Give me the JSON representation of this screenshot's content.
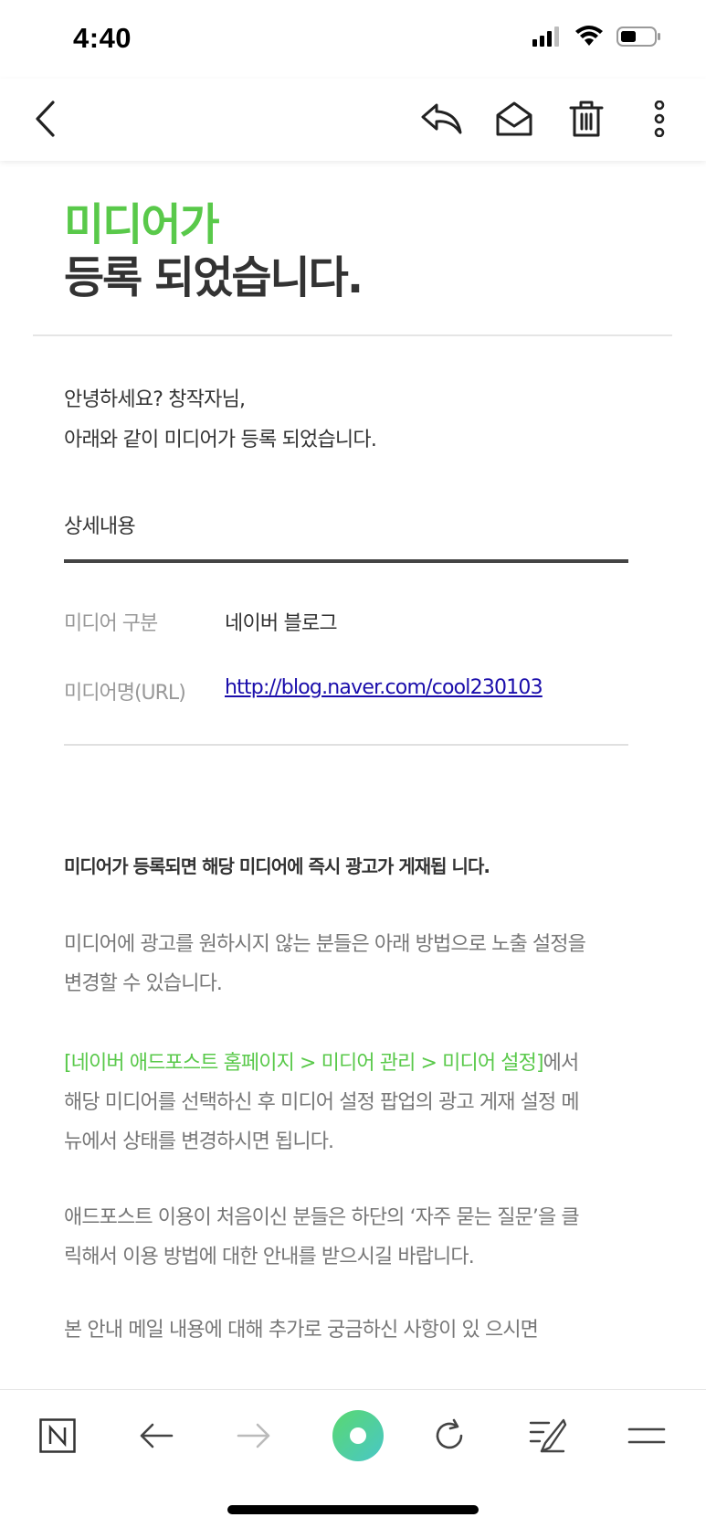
{
  "status_bar": {
    "time": "4:40"
  },
  "header": {
    "title_line1": "미디어가",
    "title_line2": "등록 되었습니다."
  },
  "greeting": {
    "line1": "안녕하세요? 창작자님,",
    "line2": "아래와 같이 미디어가 등록 되었습니다."
  },
  "details": {
    "section_label": "상세내용",
    "rows": [
      {
        "label": "미디어 구분",
        "value": "네이버 블로그"
      },
      {
        "label": "미디어명(URL)",
        "value": "http://blog.naver.com/cool230103"
      }
    ]
  },
  "body": {
    "notice_bold": "미디어가 등록되면 해당 미디어에 즉시 광고가 게재됩 니다.",
    "para1_line1": "미디어에 광고를 원하시지 않는 분들은 아래 방법으로 노출 설정을",
    "para1_line2": "변경할 수 있습니다.",
    "para2_green": "[네이버 애드포스트 홈페이지 > 미디어 관리 > 미디어 설정]",
    "para2_rest1": "에서",
    "para2_line2": "해당 미디어를 선택하신 후 미디어 설정 팝업의 광고 게재 설정 메",
    "para2_line3": "뉴에서 상태를 변경하시면 됩니다.",
    "para3_line1": "애드포스트 이용이 처음이신 분들은 하단의 ‘자주 묻는 질문’을 클",
    "para3_line2": "릭해서 이용 방법에 대한 안내를 받으시길 바랍니다.",
    "para4_line1": "본 안내 메일 내용에 대해 추가로 궁금하신 사항이 있 으시면"
  },
  "icons": {
    "status": [
      "signal-icon",
      "wifi-icon",
      "battery-icon"
    ],
    "nav": [
      "back-chevron-icon",
      "reply-icon",
      "mail-open-icon",
      "trash-icon",
      "more-vertical-icon"
    ],
    "toolbar": [
      "naver-n-icon",
      "arrow-left-icon",
      "arrow-right-icon",
      "green-circle-icon",
      "refresh-icon",
      "compose-icon",
      "menu-icon"
    ]
  },
  "colors": {
    "accent_green": "#59c94a",
    "link_blue": "#1a0dab",
    "text_dark": "#333333",
    "text_gray": "#777777"
  }
}
